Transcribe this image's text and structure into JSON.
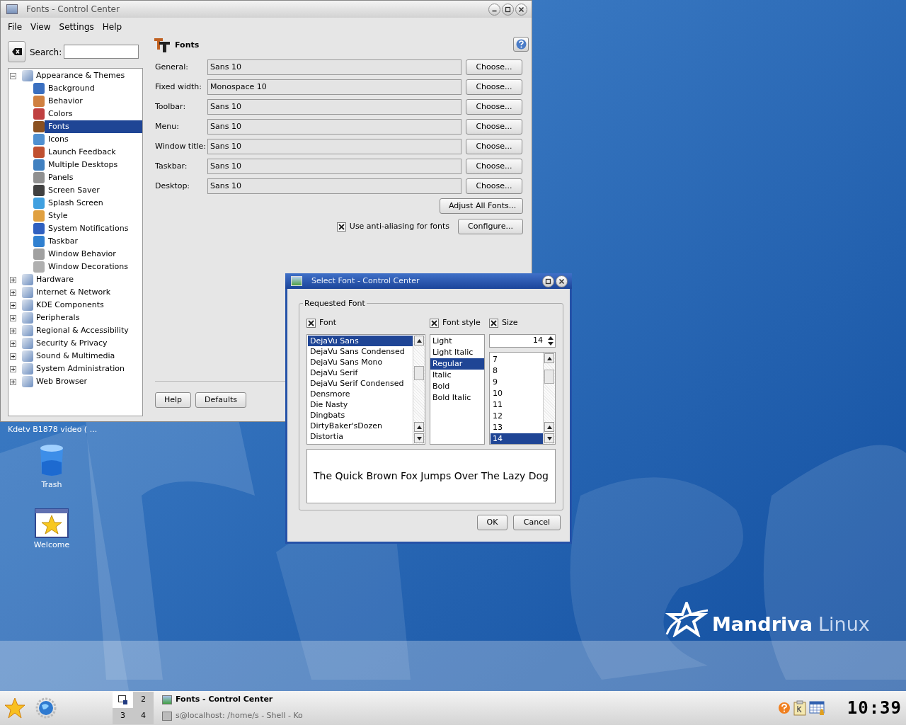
{
  "desktop": {
    "brand": "Mandriva",
    "brand_suffix": "Linux",
    "hidden_label": "Kdetv B1878 video ( ...",
    "icons": [
      {
        "label": "Trash",
        "kind": "trash"
      },
      {
        "label": "Welcome",
        "kind": "welcome"
      }
    ]
  },
  "main_window": {
    "title": "Fonts - Control Center",
    "menu": [
      "File",
      "View",
      "Settings",
      "Help"
    ],
    "search": {
      "label": "Search:"
    },
    "tree": [
      {
        "label": "Appearance & Themes",
        "expanded": true,
        "selected": false,
        "children": [
          {
            "label": "Background",
            "selected": false
          },
          {
            "label": "Behavior",
            "selected": false
          },
          {
            "label": "Colors",
            "selected": false
          },
          {
            "label": "Fonts",
            "selected": true
          },
          {
            "label": "Icons",
            "selected": false
          },
          {
            "label": "Launch Feedback",
            "selected": false
          },
          {
            "label": "Multiple Desktops",
            "selected": false
          },
          {
            "label": "Panels",
            "selected": false
          },
          {
            "label": "Screen Saver",
            "selected": false
          },
          {
            "label": "Splash Screen",
            "selected": false
          },
          {
            "label": "Style",
            "selected": false
          },
          {
            "label": "System Notifications",
            "selected": false
          },
          {
            "label": "Taskbar",
            "selected": false
          },
          {
            "label": "Window Behavior",
            "selected": false
          },
          {
            "label": "Window Decorations",
            "selected": false
          }
        ]
      },
      {
        "label": "Hardware",
        "expanded": false,
        "selected": false
      },
      {
        "label": "Internet & Network",
        "expanded": false,
        "selected": false
      },
      {
        "label": "KDE Components",
        "expanded": false,
        "selected": false
      },
      {
        "label": "Peripherals",
        "expanded": false,
        "selected": false
      },
      {
        "label": "Regional & Accessibility",
        "expanded": false,
        "selected": false
      },
      {
        "label": "Security & Privacy",
        "expanded": false,
        "selected": false
      },
      {
        "label": "Sound & Multimedia",
        "expanded": false,
        "selected": false
      },
      {
        "label": "System Administration",
        "expanded": false,
        "selected": false
      },
      {
        "label": "Web Browser",
        "expanded": false,
        "selected": false
      }
    ],
    "panel": {
      "title": "Fonts",
      "rows": [
        {
          "label": "General:",
          "value": "Sans 10",
          "button": "Choose..."
        },
        {
          "label": "Fixed width:",
          "value": "Monospace 10",
          "button": "Choose..."
        },
        {
          "label": "Toolbar:",
          "value": "Sans 10",
          "button": "Choose..."
        },
        {
          "label": "Menu:",
          "value": "Sans 10",
          "button": "Choose..."
        },
        {
          "label": "Window title:",
          "value": "Sans 10",
          "button": "Choose..."
        },
        {
          "label": "Taskbar:",
          "value": "Sans 10",
          "button": "Choose..."
        },
        {
          "label": "Desktop:",
          "value": "Sans 10",
          "button": "Choose..."
        }
      ],
      "adjust_button": "Adjust All Fonts...",
      "antialias": {
        "label": "Use anti-aliasing for fonts",
        "checked": true
      },
      "configure_button": "Configure..."
    },
    "footer_buttons": [
      "Help",
      "Defaults"
    ]
  },
  "dialog": {
    "title": "Select Font - Control Center",
    "group": "Requested Font",
    "toggles": [
      {
        "label": "Font",
        "checked": true
      },
      {
        "label": "Font style",
        "checked": true
      },
      {
        "label": "Size",
        "checked": true
      }
    ],
    "fonts": [
      {
        "label": "DejaVu Sans",
        "selected": true
      },
      {
        "label": "DejaVu Sans Condensed",
        "selected": false
      },
      {
        "label": "DejaVu Sans Mono",
        "selected": false
      },
      {
        "label": "DejaVu Serif",
        "selected": false
      },
      {
        "label": "DejaVu Serif Condensed",
        "selected": false
      },
      {
        "label": "Densmore",
        "selected": false
      },
      {
        "label": "Die Nasty",
        "selected": false
      },
      {
        "label": "Dingbats",
        "selected": false
      },
      {
        "label": "DirtyBaker'sDozen",
        "selected": false
      },
      {
        "label": "Distortia",
        "selected": false
      }
    ],
    "styles": [
      {
        "label": "Light",
        "selected": false
      },
      {
        "label": "Light Italic",
        "selected": false
      },
      {
        "label": "Regular",
        "selected": true
      },
      {
        "label": "Italic",
        "selected": false
      },
      {
        "label": "Bold",
        "selected": false
      },
      {
        "label": "Bold Italic",
        "selected": false
      }
    ],
    "size_value": "14",
    "sizes": [
      {
        "label": "7",
        "selected": false
      },
      {
        "label": "8",
        "selected": false
      },
      {
        "label": "9",
        "selected": false
      },
      {
        "label": "10",
        "selected": false
      },
      {
        "label": "11",
        "selected": false
      },
      {
        "label": "12",
        "selected": false
      },
      {
        "label": "13",
        "selected": false
      },
      {
        "label": "14",
        "selected": true
      }
    ],
    "preview": "The Quick Brown Fox Jumps Over The Lazy Dog",
    "buttons": [
      "OK",
      "Cancel"
    ]
  },
  "taskbar": {
    "pager": [
      {
        "selected": true
      },
      {
        "label": "2",
        "selected": false
      },
      {
        "label": "3",
        "selected": false
      },
      {
        "label": "4",
        "selected": false
      }
    ],
    "tasks": [
      {
        "label": "Fonts - Control Center",
        "active": true
      },
      {
        "label": "s@localhost: /home/s - Shell - Ko",
        "active": false
      }
    ],
    "clock": "10:39"
  }
}
